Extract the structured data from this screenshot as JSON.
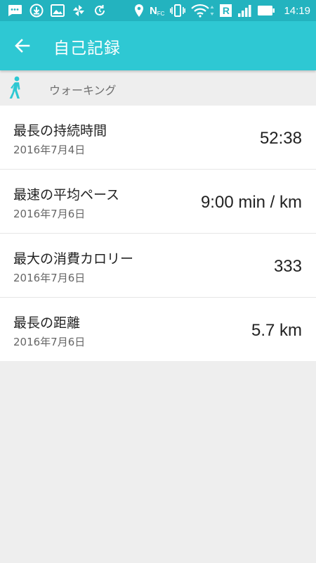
{
  "status_bar": {
    "time": "14:19",
    "icons": [
      "messages-icon",
      "download-icon",
      "image-icon",
      "pinwheel-icon",
      "sync-icon",
      "location-icon",
      "nfc-icon",
      "vibrate-icon",
      "wifi-icon",
      "roaming-r-icon",
      "signal-icon",
      "battery-icon"
    ],
    "roaming_label": "R",
    "nfc_label": "N"
  },
  "app_bar": {
    "title": "自己記録",
    "back_icon": "arrow-left-icon",
    "color": "#2ec8d3"
  },
  "category": {
    "label": "ウォーキング",
    "icon": "walking-person-icon",
    "icon_color": "#2ec8d3"
  },
  "records": [
    {
      "title": "最長の持続時間",
      "date": "2016年7月4日",
      "value": "52:38"
    },
    {
      "title": "最速の平均ペース",
      "date": "2016年7月6日",
      "value": "9:00 min / km"
    },
    {
      "title": "最大の消費カロリー",
      "date": "2016年7月6日",
      "value": "333"
    },
    {
      "title": "最長の距離",
      "date": "2016年7月6日",
      "value": "5.7 km"
    }
  ]
}
